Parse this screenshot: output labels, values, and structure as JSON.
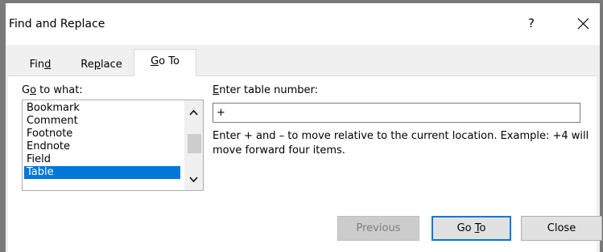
{
  "window": {
    "title": "Find and Replace",
    "help_label": "?"
  },
  "tabs": [
    {
      "label": "Find",
      "underline_char": "d",
      "active": false
    },
    {
      "label": "Replace",
      "underline_char": "p",
      "active": false
    },
    {
      "label": "Go To",
      "underline_char": "G",
      "active": true
    }
  ],
  "goto_what": {
    "label": "Go to what:",
    "items": [
      "Bookmark",
      "Comment",
      "Footnote",
      "Endnote",
      "Field",
      "Table"
    ],
    "selected": "Table"
  },
  "table_number": {
    "label": "Enter table number:",
    "value": "+"
  },
  "help_text": "Enter + and – to move relative to the current location. Example: +4 will move forward four items.",
  "buttons": {
    "previous": "Previous",
    "goto": "Go To",
    "close": "Close"
  },
  "colors": {
    "selection": "#0078d7",
    "default_button_border": "#0078d7",
    "dialog_background": "#f0f0f0"
  },
  "icons": {
    "close": "close-icon",
    "scroll_up": "chevron-up-icon",
    "scroll_down": "chevron-down-icon"
  }
}
